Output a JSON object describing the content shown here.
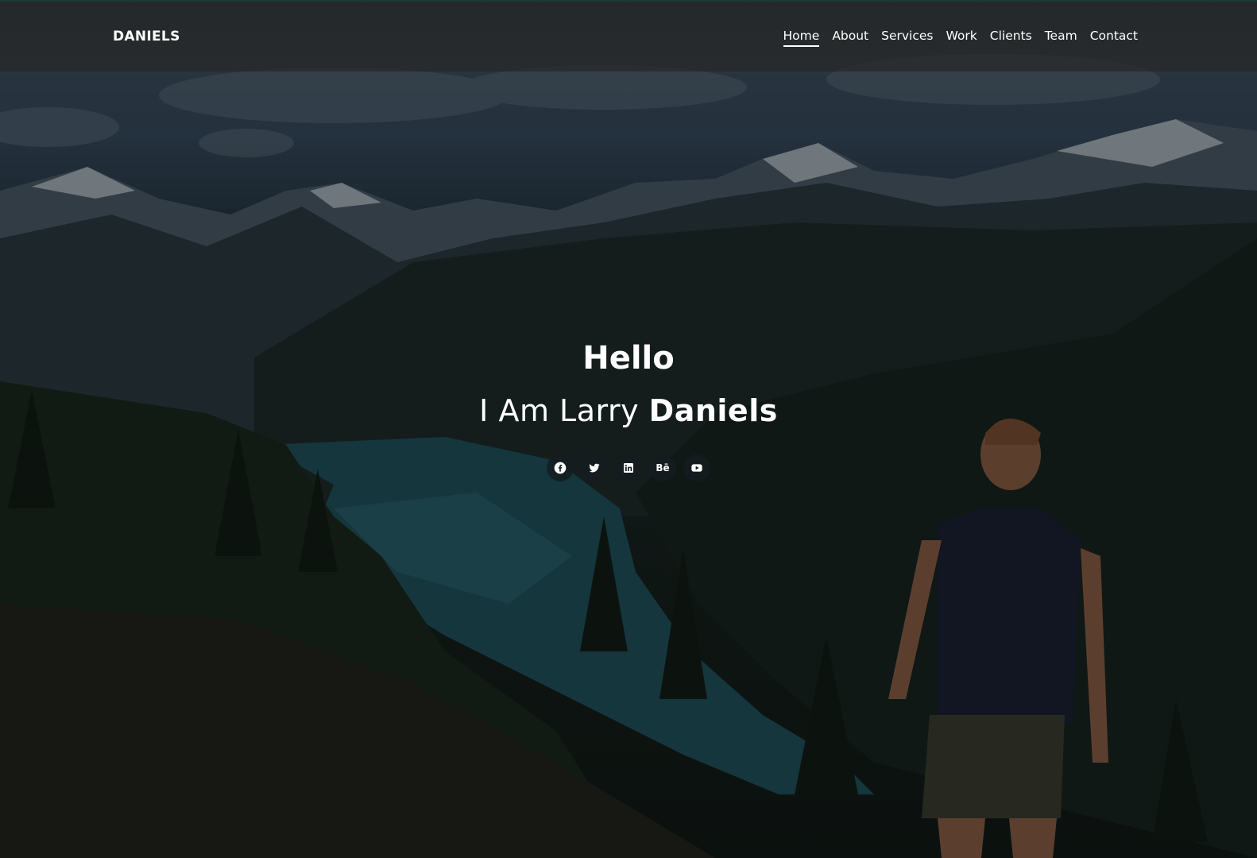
{
  "header": {
    "logo": "DANIELS",
    "nav": [
      {
        "label": "Home",
        "active": true
      },
      {
        "label": "About",
        "active": false
      },
      {
        "label": "Services",
        "active": false
      },
      {
        "label": "Work",
        "active": false
      },
      {
        "label": "Clients",
        "active": false
      },
      {
        "label": "Team",
        "active": false
      },
      {
        "label": "Contact",
        "active": false
      }
    ]
  },
  "hero": {
    "greeting": "Hello",
    "intro_prefix": "I Am Larry",
    "intro_name": "Daniels"
  },
  "socials": [
    {
      "icon": "facebook-icon"
    },
    {
      "icon": "twitter-icon"
    },
    {
      "icon": "linkedin-icon"
    },
    {
      "icon": "behance-icon",
      "glyph": "Bē"
    },
    {
      "icon": "youtube-icon"
    }
  ],
  "colors": {
    "header_bg": "#282828",
    "text": "#ffffff",
    "social_bg": "#141c20"
  }
}
